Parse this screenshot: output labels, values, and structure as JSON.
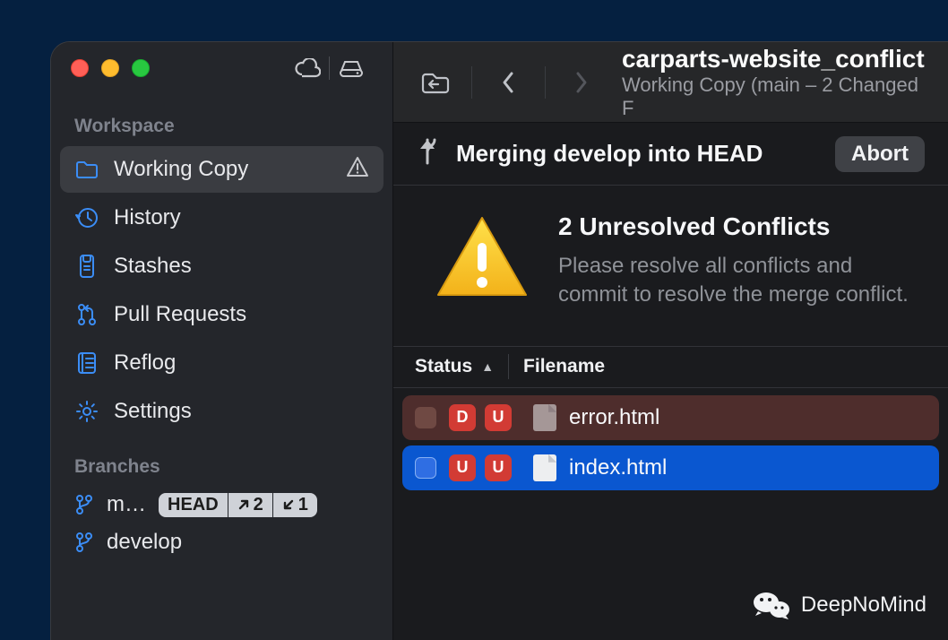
{
  "header": {
    "title": "carparts-website_conflict",
    "subtitle": "Working Copy (main – 2 Changed F"
  },
  "sidebar": {
    "workspace_header": "Workspace",
    "items": [
      {
        "label": "Working Copy",
        "icon": "folder-icon",
        "selected": true,
        "warning": true
      },
      {
        "label": "History",
        "icon": "history-icon"
      },
      {
        "label": "Stashes",
        "icon": "stash-icon"
      },
      {
        "label": "Pull Requests",
        "icon": "pull-request-icon"
      },
      {
        "label": "Reflog",
        "icon": "reflog-icon"
      },
      {
        "label": "Settings",
        "icon": "gear-icon"
      }
    ],
    "branches_header": "Branches",
    "branches": [
      {
        "name": "m…",
        "tags": {
          "head": "HEAD",
          "ahead": "2",
          "behind": "1"
        }
      },
      {
        "name": "develop"
      }
    ]
  },
  "merge": {
    "text": "Merging develop into HEAD",
    "abort": "Abort"
  },
  "conflicts": {
    "title": "2 Unresolved Conflicts",
    "description": "Please resolve all conflicts and commit to resolve the merge conflict."
  },
  "columns": {
    "status": "Status",
    "filename": "Filename"
  },
  "files": [
    {
      "status1": "D",
      "status2": "U",
      "name": "error.html",
      "style": "dark-red",
      "cb": "brown",
      "dim": true
    },
    {
      "status1": "U",
      "status2": "U",
      "name": "index.html",
      "style": "blue",
      "cb": "blue",
      "dim": false
    }
  ],
  "watermark": "DeepNoMind"
}
